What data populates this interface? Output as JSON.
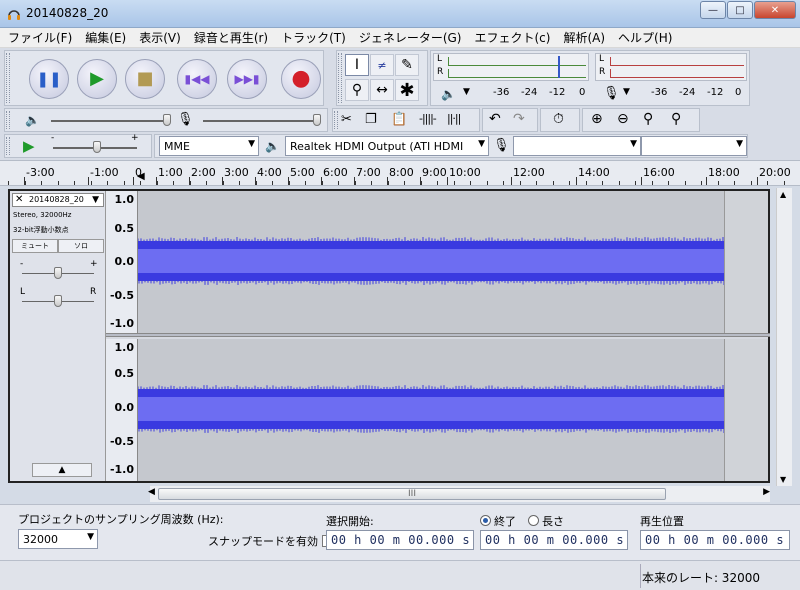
{
  "window": {
    "title": "20140828_20"
  },
  "menu": [
    "ファイル(F)",
    "編集(E)",
    "表示(V)",
    "録音と再生(r)",
    "トラック(T)",
    "ジェネレーター(G)",
    "エフェクト(c)",
    "解析(A)",
    "ヘルプ(H)"
  ],
  "meters": {
    "channel_left": "L",
    "channel_right": "R",
    "playback_ticks": [
      "-36",
      "-24",
      "-12",
      "0"
    ],
    "record_ticks": [
      "-36",
      "-24",
      "-12",
      "0"
    ]
  },
  "device": {
    "host": "MME",
    "output": "Realtek HDMI Output (ATI HDMI",
    "input": "",
    "channels": ""
  },
  "ruler": [
    "-3:00",
    "-1:00",
    "0",
    "1:00",
    "2:00",
    "3:00",
    "4:00",
    "5:00",
    "6:00",
    "7:00",
    "8:00",
    "9:00",
    "10:00",
    "12:00",
    "14:00",
    "16:00",
    "18:00",
    "20:00"
  ],
  "track": {
    "name": "20140828_20",
    "info_line1": "Stereo, 32000Hz",
    "info_line2": "32-bit浮動小数点",
    "mute": "ミュート",
    "solo": "ソロ",
    "gain_minus": "-",
    "gain_plus": "+",
    "pan_left": "L",
    "pan_right": "R",
    "scale": [
      "1.0",
      "0.5",
      "0.0",
      "-0.5",
      "-1.0"
    ]
  },
  "selection": {
    "rate_label": "プロジェクトのサンプリング周波数 (Hz):",
    "rate_value": "32000",
    "snap_label": "スナップモードを有効",
    "start_label": "選択開始:",
    "end_label": "終了",
    "length_label": "長さ",
    "position_label": "再生位置",
    "start_time": "00 h 00 m 00.000 s",
    "end_time": "00 h 00 m 00.000 s",
    "position_time": "00 h 00 m 00.000 s"
  },
  "status": {
    "actual_rate": "本来のレート: 32000"
  },
  "hscroll_grip": "III"
}
